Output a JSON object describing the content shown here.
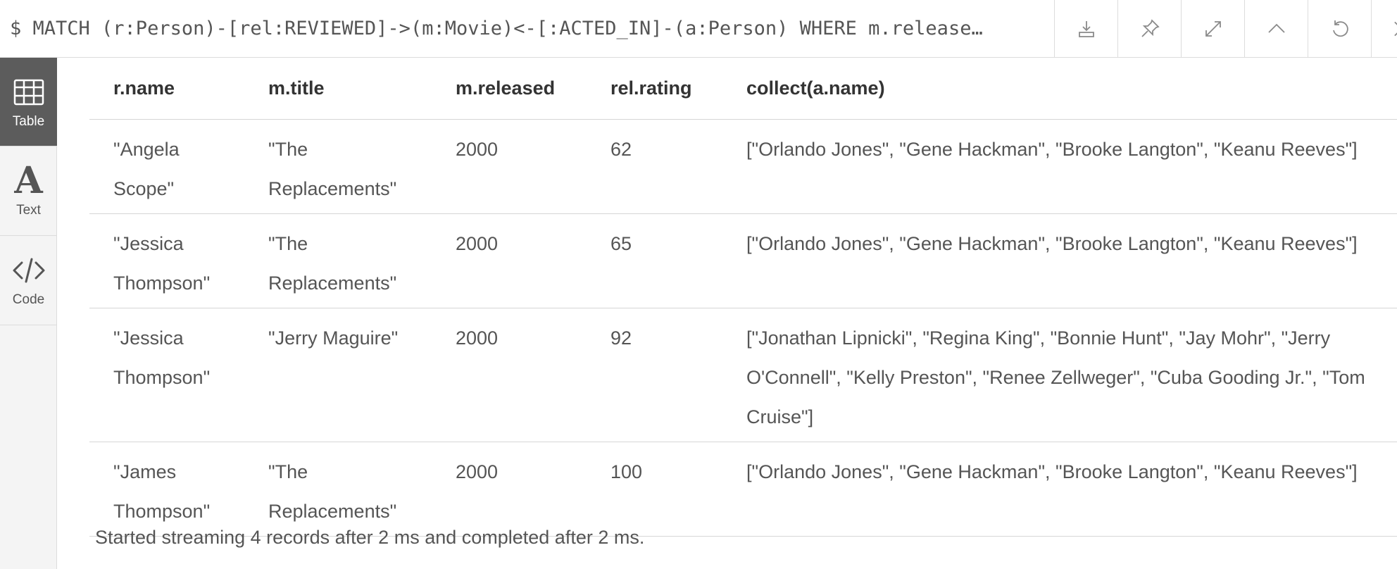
{
  "header": {
    "query": "$ MATCH (r:Person)-[rel:REVIEWED]->(m:Movie)<-[:ACTED_IN]-(a:Person) WHERE m.release…"
  },
  "toolbar": {
    "buttons": [
      "download-icon",
      "pin-icon",
      "expand-icon",
      "collapse-up-icon",
      "rerun-icon",
      "close-icon"
    ]
  },
  "sidebar": {
    "tabs": [
      {
        "label": "Table",
        "icon": "table-icon",
        "active": true
      },
      {
        "label": "Text",
        "icon": "text-icon",
        "active": false
      },
      {
        "label": "Code",
        "icon": "code-icon",
        "active": false
      }
    ]
  },
  "table": {
    "columns": [
      "r.name",
      "m.title",
      "m.released",
      "rel.rating",
      "collect(a.name)"
    ],
    "rows": [
      [
        "\"Angela Scope\"",
        "\"The Replacements\"",
        "2000",
        "62",
        "[\"Orlando Jones\", \"Gene Hackman\", \"Brooke Langton\", \"Keanu Reeves\"]"
      ],
      [
        "\"Jessica Thompson\"",
        "\"The Replacements\"",
        "2000",
        "65",
        "[\"Orlando Jones\", \"Gene Hackman\", \"Brooke Langton\", \"Keanu Reeves\"]"
      ],
      [
        "\"Jessica Thompson\"",
        "\"Jerry Maguire\"",
        "2000",
        "92",
        "[\"Jonathan Lipnicki\", \"Regina King\", \"Bonnie Hunt\", \"Jay Mohr\", \"Jerry O'Connell\", \"Kelly Preston\", \"Renee Zellweger\", \"Cuba Gooding Jr.\", \"Tom Cruise\"]"
      ],
      [
        "\"James Thompson\"",
        "\"The Replacements\"",
        "2000",
        "100",
        "[\"Orlando Jones\", \"Gene Hackman\", \"Brooke Langton\", \"Keanu Reeves\"]"
      ]
    ]
  },
  "status": {
    "text": "Started streaming 4 records after 2 ms and completed after 2 ms."
  },
  "colors": {
    "active_tab": "#5c5c5c",
    "sidebar_bg": "#f4f4f4",
    "border": "#dcdcdc"
  }
}
